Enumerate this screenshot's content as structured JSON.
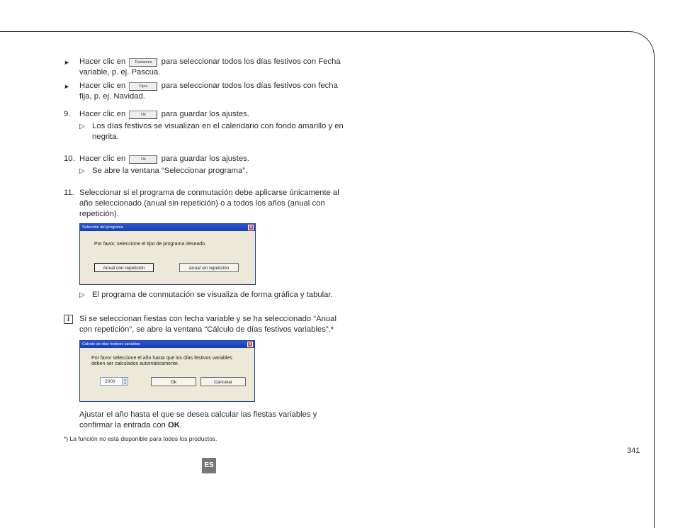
{
  "bullets": [
    {
      "marker": "►",
      "before": "Hacer clic en",
      "button": "Festantes",
      "after": "para seleccionar todos los días festivos con Fecha variable, p. ej. Pascua."
    },
    {
      "marker": "►",
      "before": "Hacer clic en",
      "button": "Fijos",
      "after": "para seleccionar todos los días festivos con fecha fija, p. ej. Navidad."
    }
  ],
  "steps": [
    {
      "num": "9.",
      "before": "Hacer clic en",
      "button": "Ok",
      "after": "para guardar los ajustes.",
      "result": "Los días festivos se visualizan en el calendario con fondo amarillo y en negrita."
    },
    {
      "num": "10.",
      "before": "Hacer clic en",
      "button": "Ok",
      "after": "para guardar los ajustes.",
      "result": "Se abre la ventana “Seleccionar programa”."
    },
    {
      "num": "11.",
      "text": "Seleccionar si el programa de conmutación debe aplicarse únicamente al año seleccionado (anual sin repetición) o a todos los años (anual con repetición).",
      "result": "El programa de conmutación se visualiza de forma gráfica y tabular."
    }
  ],
  "result_marker": "▷",
  "dialog1": {
    "title": "Selección del programa",
    "close": "x",
    "message": "Por favor, seleccione el tipo de programa deseado.",
    "btn_repeat": "Anual con repetición",
    "btn_no_repeat": "Anual sin repetición"
  },
  "note": {
    "icon": "i",
    "text": "Si se seleccionan fiestas con fecha variable y se ha seleccionado “Anual con repetición”, se abre la ventana “Cálculo de días festivos variables”.*"
  },
  "dialog2": {
    "title": "Cálculo de días festivos variables",
    "close": "x",
    "message": "Por favor seleccione el año hasta que los días festivos variables deben ser calculados automáticamente.",
    "year": "2000",
    "ok": "Ok",
    "cancel": "Cancelar"
  },
  "after_text_before": "Ajustar el año hasta el que se desea calcular las fiestas variables y confirmar la entrada con",
  "after_text_bold": "OK",
  "after_text_end": ".",
  "footnote": "*)  La función no está disponible para todos los productos.",
  "page_number": "341",
  "language": "ES"
}
